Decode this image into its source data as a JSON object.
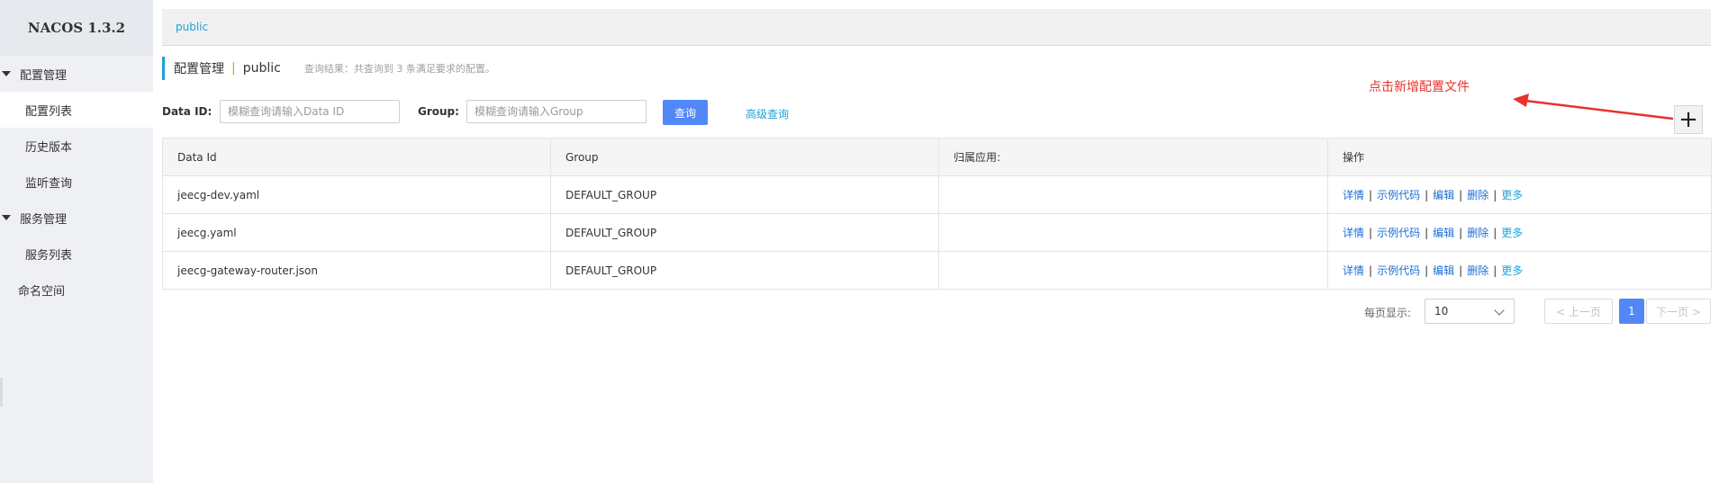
{
  "sidebar": {
    "brand": "NACOS 1.3.2",
    "groups": [
      {
        "label": "配置管理",
        "items": [
          "配置列表",
          "历史版本",
          "监听查询"
        ]
      },
      {
        "label": "服务管理",
        "items": [
          "服务列表"
        ]
      }
    ],
    "namespace_item": "命名空间"
  },
  "topbar": {
    "namespace_tab": "public"
  },
  "title": {
    "main": "配置管理",
    "separator": "|",
    "namespace": "public",
    "info": "查询结果：共查询到 3 条满足要求的配置。"
  },
  "search": {
    "dataid_label": "Data ID:",
    "dataid_placeholder": "模糊查询请输入Data ID",
    "group_label": "Group:",
    "group_placeholder": "模糊查询请输入Group",
    "query_button": "查询",
    "advanced_link": "高级查询"
  },
  "annotation": {
    "text": "点击新增配置文件",
    "color": "#e8322c"
  },
  "add_button": {
    "icon": "plus-icon",
    "glyph": "+"
  },
  "table": {
    "headers": [
      "Data Id",
      "Group",
      "归属应用:",
      "操作"
    ],
    "rows": [
      {
        "data_id": "jeecg-dev.yaml",
        "group": "DEFAULT_GROUP",
        "app": ""
      },
      {
        "data_id": "jeecg.yaml",
        "group": "DEFAULT_GROUP",
        "app": ""
      },
      {
        "data_id": "jeecg-gateway-router.json",
        "group": "DEFAULT_GROUP",
        "app": ""
      }
    ],
    "actions": {
      "detail": "详情",
      "sample": "示例代码",
      "edit": "编辑",
      "delete": "删除",
      "more": "更多",
      "separator": "|"
    }
  },
  "pagination": {
    "per_page_label": "每页显示:",
    "page_size": "10",
    "prev": "< 上一页",
    "current_page": "1",
    "next": "下一页 >"
  },
  "colors": {
    "accent": "#5287f7",
    "link": "#1ea3d8",
    "action_link": "#1b6fd6",
    "sidebar_bg": "#eef0f3"
  }
}
